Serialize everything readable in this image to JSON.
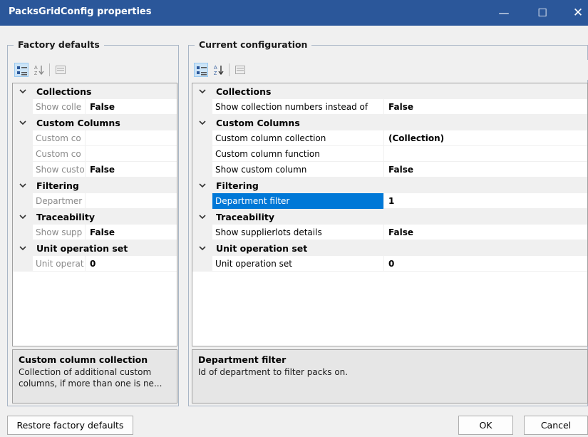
{
  "window": {
    "title": "PacksGridConfig properties",
    "controls": {
      "minimize": "—",
      "maximize": "☐",
      "close": "✕"
    }
  },
  "factory": {
    "caption": "Factory defaults",
    "description": {
      "title": "Custom column collection",
      "text": "Collection of additional custom columns, if more than one is ne..."
    }
  },
  "current": {
    "caption": "Current configuration",
    "description": {
      "title": "Department filter",
      "text": "Id of department to filter packs on."
    }
  },
  "grid": {
    "categories": [
      {
        "name": "Collections",
        "props": [
          {
            "factory_name": "Show colle",
            "current_name": "Show collection numbers instead of",
            "factory_value": "False",
            "current_value": "False"
          }
        ]
      },
      {
        "name": "Custom Columns",
        "props": [
          {
            "factory_name": "Custom co",
            "current_name": "Custom column collection",
            "factory_value": "",
            "current_value": "(Collection)"
          },
          {
            "factory_name": "Custom co",
            "current_name": "Custom column function",
            "factory_value": "",
            "current_value": ""
          },
          {
            "factory_name": "Show custo",
            "current_name": "Show custom column",
            "factory_value": "False",
            "current_value": "False"
          }
        ]
      },
      {
        "name": "Filtering",
        "props": [
          {
            "factory_name": "Departmer",
            "current_name": "Department filter",
            "factory_value": "",
            "current_value": "1"
          }
        ]
      },
      {
        "name": "Traceability",
        "props": [
          {
            "factory_name": "Show supp",
            "current_name": "Show supplierlots details",
            "factory_value": "False",
            "current_value": "False"
          }
        ]
      },
      {
        "name": "Unit operation set",
        "props": [
          {
            "factory_name": "Unit operat",
            "current_name": "Unit operation set",
            "factory_value": "0",
            "current_value": "0"
          }
        ]
      }
    ]
  },
  "buttons": {
    "restore": "Restore factory defaults",
    "ok": "OK",
    "cancel": "Cancel"
  },
  "colors": {
    "titlebar": "#2b579a",
    "selection": "#0078d7",
    "accent_border": "#a9b6c6"
  }
}
